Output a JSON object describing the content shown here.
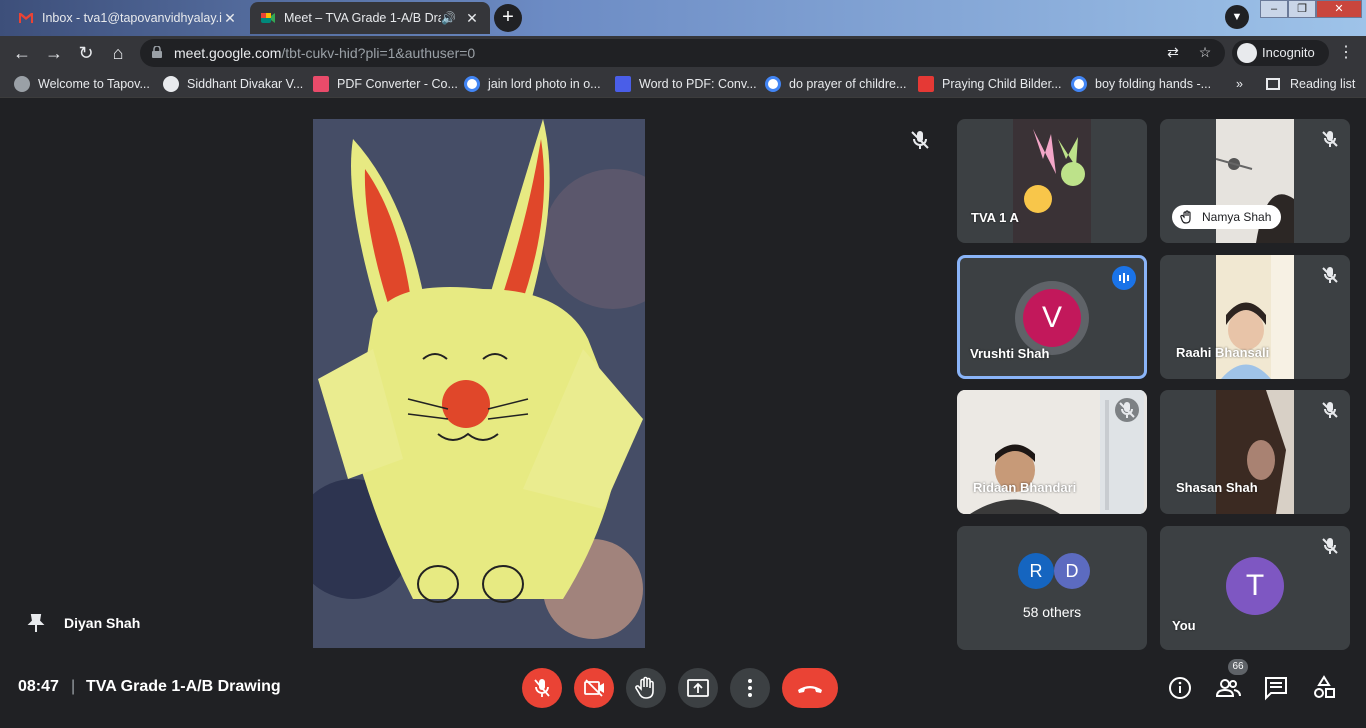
{
  "browser": {
    "tabs": [
      {
        "title": "Inbox - tva1@tapovanvidhyalay.i",
        "active": false
      },
      {
        "title": "Meet – TVA Grade 1-A/B Dra",
        "active": true
      }
    ],
    "new_tab_label": "+",
    "url_host": "meet.google.com",
    "url_path": "/tbt-cukv-hid?pli=1&authuser=0",
    "profile_label": "Incognito",
    "bookmarks": [
      "Welcome to Tapov...",
      "Siddhant Divakar V...",
      "PDF Converter - Co...",
      "jain lord photo in o...",
      "Word to PDF: Conv...",
      "do prayer of childre...",
      "Praying Child Bilder...",
      "boy folding hands -..."
    ],
    "bookmarks_overflow": "»",
    "reading_list": "Reading list"
  },
  "meet": {
    "pinned_name": "Diyan Shah",
    "tiles": [
      {
        "name": "TVA 1 A"
      },
      {
        "name": "Namya Shah",
        "hand_raised": true
      },
      {
        "name": "Vrushti Shah",
        "initial": "V",
        "speaking": true
      },
      {
        "name": "Raahi Bhansali"
      },
      {
        "name": "Ridaan Bhandari"
      },
      {
        "name": "Shasan Shah"
      },
      {
        "others_initials": [
          "R",
          "D"
        ],
        "label": "58 others"
      },
      {
        "name": "You",
        "initial": "T"
      }
    ],
    "time": "08:47",
    "separator": "|",
    "meeting_title": "TVA Grade 1-A/B Drawing",
    "participants_count": "66"
  },
  "colors": {
    "red": "#ea4335",
    "tile_bg": "#3c4043",
    "accent": "#8ab4f8",
    "avatar_v": "#c2185b",
    "avatar_t": "#7e57c2",
    "avatar_r": "#1565c0",
    "avatar_d": "#5c6bc0"
  }
}
